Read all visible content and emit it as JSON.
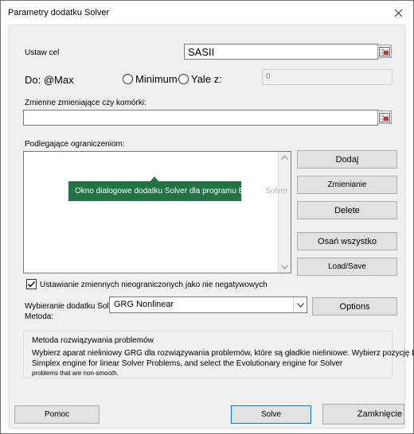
{
  "window": {
    "title": "Parametry dodatku Solver"
  },
  "objective": {
    "label": "Ustaw cel",
    "value": "SASII"
  },
  "to": {
    "label": "Do: @Max",
    "minimum_label": "Minimum",
    "value_of_label": "Yale z:",
    "value_of_value": "0"
  },
  "changing": {
    "label": "Zmienne zmieniające czy komórki:",
    "value": ""
  },
  "constraints": {
    "label": "Podlegające ograniczeniom:",
    "tooltip": "Okno dialogowe dodatku Solver dla programu Excel",
    "tooltip_ghost": "Okno dialogowe dodatku Solver dla programu Excel",
    "buttons": {
      "add": "Dodaj",
      "change": "Zmienianie",
      "delete": "Delete",
      "reset_all": "Osań wszystko",
      "load_save": "Load/Save"
    }
  },
  "unconstrained": {
    "label": "Ustawianie zmiennych nieograniczonych jako nie negatywowych",
    "checked": true
  },
  "method": {
    "label_line1": "Wybieranie dodatku Solver",
    "label_line2": "Metoda:",
    "selected": "GRG Nonlinear",
    "options_button": "Options"
  },
  "description": {
    "title": "Metoda rozwiązywania problemów",
    "line1": "Wybierz aparat nieliniowy GRG dla rozwiązywania problemów, które są gładkie nieliniowe. Wybierz pozycję LP",
    "line2": "Simplex engine for linear Solver Problems, and select the Evolutionary engine for Solver",
    "line3": "problems that are non-smooth."
  },
  "footer": {
    "help": "Pomoc",
    "solve": "Solve",
    "close": "Zamknięcie"
  }
}
